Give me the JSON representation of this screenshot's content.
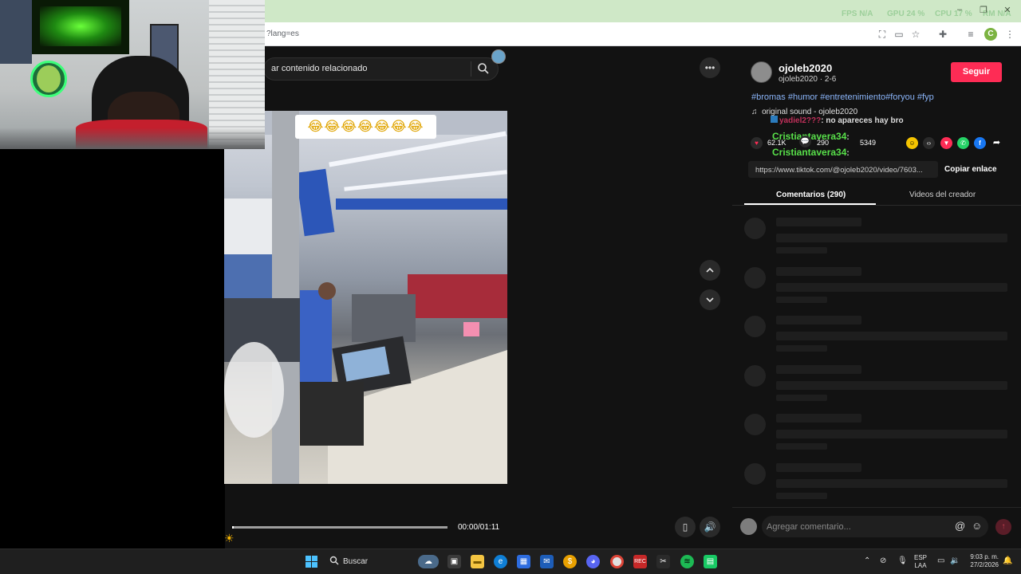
{
  "window": {
    "overlay_stats": [
      "FPS N/A",
      "GPU 24 %",
      "CPU 17 %",
      "RM N/A"
    ]
  },
  "browser": {
    "url": "?lang=es",
    "profile_initial": "C"
  },
  "search": {
    "placeholder": "ar contenido relacionado"
  },
  "video": {
    "caption": "😂😂😂😂😂😂😂",
    "timecode": "00:00/01:11",
    "progress": 0.0
  },
  "author": {
    "name": "ojoleb2020",
    "subtitle": "ojoleb2020 · 2-6",
    "follow_label": "Seguir"
  },
  "post": {
    "hashtags": "#bromas #humor #entretenimiento#foryou #fyp",
    "sound": "original sound - ojoleb2020",
    "likes": "62.1K",
    "comments": "290",
    "shares": "5349",
    "link": "https://www.tiktok.com/@ojoleb2020/video/7603...",
    "copy_label": "Copiar enlace"
  },
  "chat_overlay": [
    {
      "user": "yadiel2???",
      "message": ": no apareces hay bro"
    },
    {
      "user": "Cristiantavera34",
      "message": ":"
    },
    {
      "user": "Cristiantavera34",
      "message": ":"
    }
  ],
  "tabs": {
    "comments": "Comentarios (290)",
    "creator_videos": "Videos del creador"
  },
  "comment_box": {
    "placeholder": "Agregar comentario..."
  },
  "taskbar": {
    "search_label": "Buscar",
    "lang_top": "ESP",
    "lang_bottom": "LAA",
    "time": "9:03 p. m.",
    "date": "27/2/2026"
  }
}
